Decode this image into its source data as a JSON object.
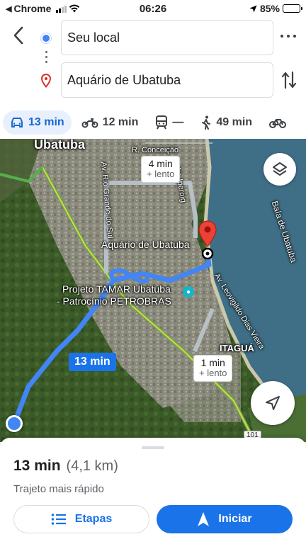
{
  "status_bar": {
    "back_app": "Chrome",
    "time": "06:26",
    "battery": "85%",
    "battery_level": 0.85
  },
  "directions": {
    "from_value": "Seu local",
    "to_value": "Aquário de Ubatuba"
  },
  "modes": [
    {
      "id": "car",
      "icon": "car-icon",
      "label": "13 min",
      "active": true
    },
    {
      "id": "motorcycle",
      "icon": "motorcycle-icon",
      "label": "12 min",
      "active": false
    },
    {
      "id": "transit",
      "icon": "train-icon",
      "label": "—",
      "active": false
    },
    {
      "id": "walk",
      "icon": "walking-icon",
      "label": "49 min",
      "active": false
    },
    {
      "id": "bike",
      "icon": "bicycle-icon",
      "label": "",
      "active": false
    }
  ],
  "map": {
    "labels": {
      "town": "Ubatuba",
      "street_conceicao": "R. Conceição",
      "street_iperoig": "Av. Iperoig",
      "street_rio_grande": "Av. Rio Grande do Sul",
      "destination": "Aquário de Ubatuba",
      "tamar_line1": "Projeto TAMAR Ubatuba",
      "tamar_line2": "- Patrocínio PETROBRAS",
      "bay": "Baía de Ubatuba",
      "itagua": "ITAGUÁ",
      "avenue_leovigildo": "Av. Leovigildo Dias Vieira",
      "road_shield": "101"
    },
    "alt_route_1": {
      "time": "4 min",
      "sub": "+ lento"
    },
    "alt_route_2": {
      "time": "1 min",
      "sub": "+ lento"
    },
    "main_route_time": "13 min",
    "colors": {
      "route": "#4285f4",
      "alt_route": "#b7c0c7",
      "pin": "#ea4335",
      "water": "#3f6f86",
      "vegetation": "#3d5a2a"
    }
  },
  "sheet": {
    "duration": "13 min",
    "distance": "(4,1 km)",
    "note": "Trajeto mais rápido",
    "steps_label": "Etapas",
    "start_label": "Iniciar"
  }
}
